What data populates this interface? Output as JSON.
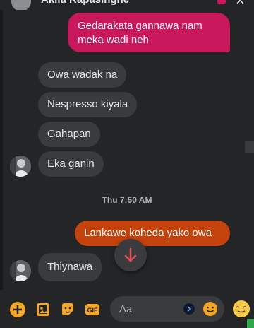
{
  "header": {
    "contact_name": "Akila Rapasinghe"
  },
  "messages": [
    {
      "dir": "out",
      "text": "Gedarakata gannawa nam meka wadi neh"
    },
    {
      "dir": "in",
      "text": "Owa wadak na"
    },
    {
      "dir": "in",
      "text": "Nespresso kiyala"
    },
    {
      "dir": "in",
      "text": "Gahapan"
    },
    {
      "dir": "in",
      "text": "Eka ganin"
    },
    {
      "dir": "out",
      "text": "Lankawe koheda yako owa"
    },
    {
      "dir": "in",
      "text": "Thiynawa"
    }
  ],
  "timestamp": "Thu 7:50 AM",
  "composer": {
    "placeholder": "Aa"
  },
  "colors": {
    "background": "#242526",
    "incoming_bubble": "#3a3b3c",
    "outgoing_pink": "#c8175a",
    "outgoing_orange": "#c4420b",
    "accent_icons": "#f5a623",
    "scroll_arrow": "#e8505b"
  },
  "icons": [
    "plus-circle-icon",
    "image-icon",
    "sticker-icon",
    "gif-icon",
    "emoji-icon",
    "like-emoji-icon",
    "arrow-down-icon",
    "call-icon",
    "close-icon"
  ]
}
